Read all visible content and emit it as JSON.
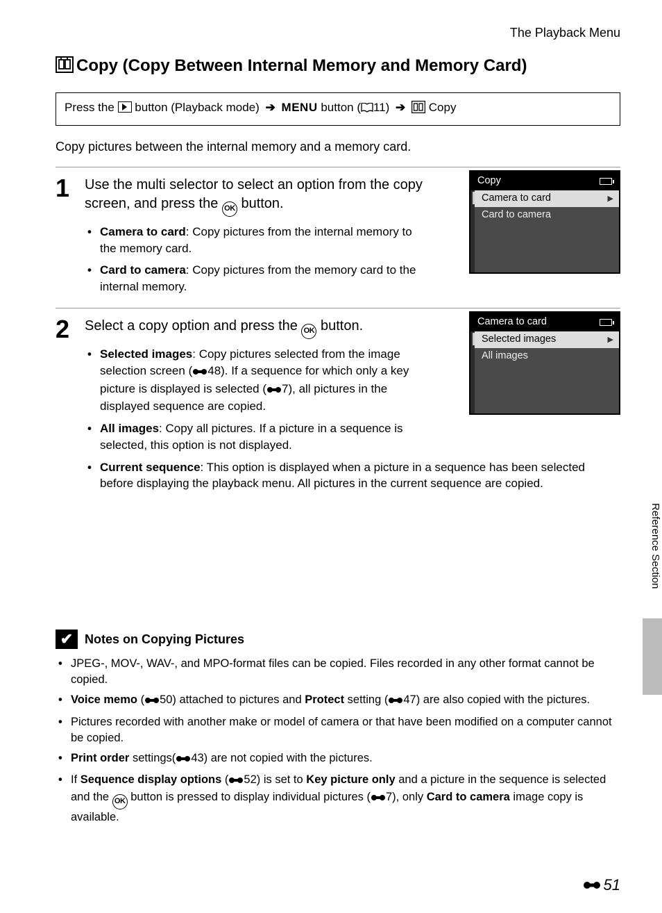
{
  "header": "The Playback Menu",
  "title_prefix_icon": "copy",
  "title": "Copy (Copy Between Internal Memory and Memory Card)",
  "nav": {
    "t1": "Press the",
    "t2": "button (Playback mode)",
    "menu_word": "MENU",
    "t3": "button (",
    "ref11": "11)",
    "copy_word": "Copy"
  },
  "intro": "Copy pictures between the internal memory and a memory card.",
  "step1": {
    "num": "1",
    "head_a": "Use the multi selector to select an option from the copy screen, and press the ",
    "head_b": " button.",
    "b1_bold": "Camera to card",
    "b1_rest": ": Copy pictures from the internal memory to the memory card.",
    "b2_bold": "Card to camera",
    "b2_rest": ": Copy pictures from the memory card to the internal memory."
  },
  "cam1": {
    "title": "Copy",
    "opt1": "Camera to card",
    "opt2": "Card to camera"
  },
  "step2": {
    "num": "2",
    "head_a": "Select a copy option and press the ",
    "head_b": " button.",
    "b1_bold": "Selected images",
    "b1_a": ": Copy pictures selected from the image selection screen (",
    "b1_ref1": "48). If a sequence for which only a key picture is displayed is selected (",
    "b1_ref2": "7), all pictures in the displayed sequence are copied.",
    "b2_bold": "All images",
    "b2_rest": ": Copy all pictures. If a picture in a sequence is selected, this option is not displayed.",
    "b3_bold": "Current sequence",
    "b3_rest": ": This option is displayed when a picture in a sequence has been selected before displaying the playback menu. All pictures in the current sequence are copied."
  },
  "cam2": {
    "title": "Camera to card",
    "opt1": "Selected images",
    "opt2": "All images"
  },
  "notes": {
    "title": "Notes on Copying Pictures",
    "n1": "JPEG-, MOV-, WAV-, and MPO-format files can be copied. Files recorded in any other format cannot be copied.",
    "n2_a_bold": "Voice memo",
    "n2_a": " (",
    "n2_ref1": "50) attached to pictures and ",
    "n2_b_bold": "Protect",
    "n2_b": " setting (",
    "n2_ref2": "47) are also copied with the pictures.",
    "n3": "Pictures recorded with another make or model of camera or that have been modified on a computer cannot be copied.",
    "n4_bold": "Print order",
    "n4_a": " settings(",
    "n4_ref": "43) are not copied with the pictures.",
    "n5_a": "If ",
    "n5_b1": "Sequence display options",
    "n5_b": " (",
    "n5_ref1": "52) is set to ",
    "n5_b2": "Key picture only",
    "n5_c": " and a picture in the sequence is selected and the ",
    "n5_d": " button is pressed to display individual pictures (",
    "n5_ref2": "7), only ",
    "n5_b3": "Card to camera",
    "n5_e": " image copy is available."
  },
  "side_label": "Reference Section",
  "page_number": "51"
}
